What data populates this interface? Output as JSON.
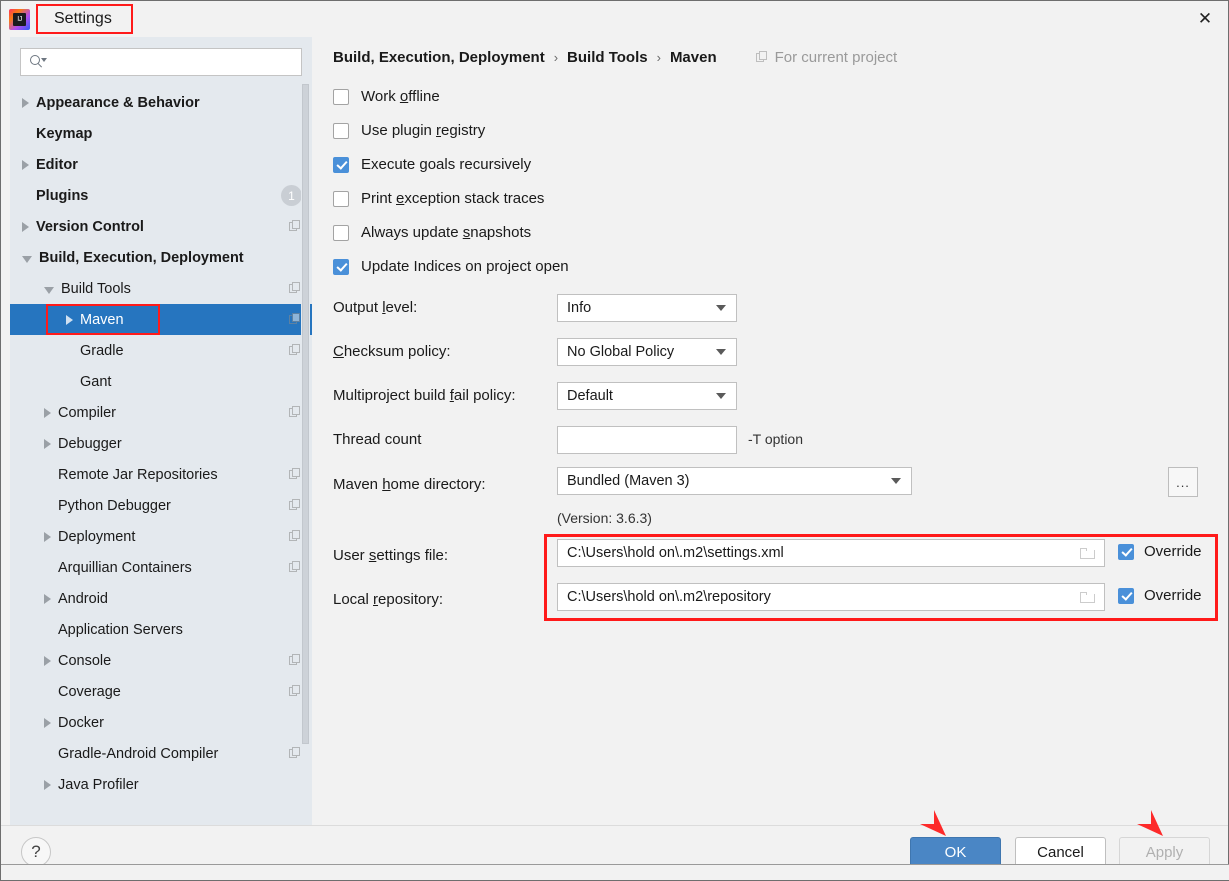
{
  "window": {
    "title": "Settings",
    "logo_icon": "intellij-idea-logo",
    "close_icon": "close-icon"
  },
  "sidebar": {
    "search": {
      "value": "",
      "placeholder": "",
      "icon": "search-icon"
    },
    "items": [
      {
        "label": "Appearance & Behavior",
        "indent": 0,
        "arrow": "collapsed",
        "bold": true,
        "copy": false,
        "badge": null
      },
      {
        "label": "Keymap",
        "indent": 0,
        "arrow": "none",
        "bold": true,
        "copy": false,
        "badge": null
      },
      {
        "label": "Editor",
        "indent": 0,
        "arrow": "collapsed",
        "bold": true,
        "copy": false,
        "badge": null
      },
      {
        "label": "Plugins",
        "indent": 0,
        "arrow": "none",
        "bold": true,
        "copy": false,
        "badge": "1"
      },
      {
        "label": "Version Control",
        "indent": 0,
        "arrow": "collapsed",
        "bold": true,
        "copy": true,
        "badge": null
      },
      {
        "label": "Build, Execution, Deployment",
        "indent": 0,
        "arrow": "expanded",
        "bold": true,
        "copy": false,
        "badge": null
      },
      {
        "label": "Build Tools",
        "indent": 1,
        "arrow": "expanded",
        "bold": false,
        "copy": true,
        "badge": null
      },
      {
        "label": "Maven",
        "indent": 2,
        "arrow": "collapsed",
        "bold": false,
        "copy": true,
        "badge": null,
        "selected": true
      },
      {
        "label": "Gradle",
        "indent": 2,
        "arrow": "none",
        "bold": false,
        "copy": true,
        "badge": null
      },
      {
        "label": "Gant",
        "indent": 2,
        "arrow": "none",
        "bold": false,
        "copy": false,
        "badge": null
      },
      {
        "label": "Compiler",
        "indent": 1,
        "arrow": "collapsed",
        "bold": false,
        "copy": true,
        "badge": null
      },
      {
        "label": "Debugger",
        "indent": 1,
        "arrow": "collapsed",
        "bold": false,
        "copy": false,
        "badge": null
      },
      {
        "label": "Remote Jar Repositories",
        "indent": 1,
        "arrow": "none",
        "bold": false,
        "copy": true,
        "badge": null
      },
      {
        "label": "Python Debugger",
        "indent": 1,
        "arrow": "none",
        "bold": false,
        "copy": true,
        "badge": null
      },
      {
        "label": "Deployment",
        "indent": 1,
        "arrow": "collapsed",
        "bold": false,
        "copy": true,
        "badge": null
      },
      {
        "label": "Arquillian Containers",
        "indent": 1,
        "arrow": "none",
        "bold": false,
        "copy": true,
        "badge": null
      },
      {
        "label": "Android",
        "indent": 1,
        "arrow": "collapsed",
        "bold": false,
        "copy": false,
        "badge": null
      },
      {
        "label": "Application Servers",
        "indent": 1,
        "arrow": "none",
        "bold": false,
        "copy": false,
        "badge": null
      },
      {
        "label": "Console",
        "indent": 1,
        "arrow": "collapsed",
        "bold": false,
        "copy": true,
        "badge": null
      },
      {
        "label": "Coverage",
        "indent": 1,
        "arrow": "none",
        "bold": false,
        "copy": true,
        "badge": null
      },
      {
        "label": "Docker",
        "indent": 1,
        "arrow": "collapsed",
        "bold": false,
        "copy": false,
        "badge": null
      },
      {
        "label": "Gradle-Android Compiler",
        "indent": 1,
        "arrow": "none",
        "bold": false,
        "copy": true,
        "badge": null
      },
      {
        "label": "Java Profiler",
        "indent": 1,
        "arrow": "collapsed",
        "bold": false,
        "copy": false,
        "badge": null
      }
    ]
  },
  "breadcrumb": {
    "crumbs": [
      "Build, Execution, Deployment",
      "Build Tools",
      "Maven"
    ],
    "separator": "›",
    "scope_label": "For current project",
    "scope_icon": "copy-icon"
  },
  "checkboxes": [
    {
      "label_pre": "Work ",
      "mnemonic": "o",
      "label_post": "ffline",
      "checked": false
    },
    {
      "label_pre": "Use plugin ",
      "mnemonic": "r",
      "label_post": "egistry",
      "checked": false
    },
    {
      "label_pre": "Execute ",
      "mnemonic": "g",
      "label_post": "oals recursively",
      "checked": true
    },
    {
      "label_pre": "Print ",
      "mnemonic": "e",
      "label_post": "xception stack traces",
      "checked": false
    },
    {
      "label_pre": "Always update ",
      "mnemonic": "s",
      "label_post": "napshots",
      "checked": false
    },
    {
      "label_pre": "Update Indices on project open",
      "mnemonic": "",
      "label_post": "",
      "checked": true
    }
  ],
  "fields": {
    "output_level": {
      "label_pre": "Output ",
      "mnemonic": "l",
      "label_post": "evel:",
      "value": "Info"
    },
    "checksum_policy": {
      "label_pre": "",
      "mnemonic": "C",
      "label_post": "hecksum policy:",
      "value": "No Global Policy"
    },
    "multiproject_fail_policy": {
      "label_pre": "Multiproject build ",
      "mnemonic": "f",
      "label_post": "ail policy:",
      "value": "Default"
    },
    "thread_count": {
      "label_pre": "Thread count",
      "mnemonic": "",
      "label_post": "",
      "value": "",
      "hint": "-T option"
    },
    "maven_home": {
      "label_pre": "Maven ",
      "mnemonic": "h",
      "label_post": "ome directory:",
      "value": "Bundled (Maven 3)",
      "browse_label": "...",
      "version_note": "(Version: 3.6.3)"
    },
    "user_settings_file": {
      "label_pre": "User ",
      "mnemonic": "s",
      "label_post": "ettings file:",
      "value": "C:\\Users\\hold on\\.m2\\settings.xml",
      "override_label": "Override",
      "override_checked": true
    },
    "local_repository": {
      "label_pre": "Local ",
      "mnemonic": "r",
      "label_post": "epository:",
      "value": "C:\\Users\\hold on\\.m2\\repository",
      "override_label": "Override",
      "override_checked": true
    }
  },
  "footer": {
    "help_label": "?",
    "ok_label": "OK",
    "cancel_label": "Cancel",
    "apply_label": "Apply"
  },
  "colors": {
    "selection_blue": "#2675bf",
    "checkbox_blue": "#4a90d9",
    "ok_button_blue": "#4a86c5",
    "annotation_red": "#ff1a1a",
    "sidebar_bg": "#e4e9ee",
    "panel_bg": "#f2f2f2"
  }
}
